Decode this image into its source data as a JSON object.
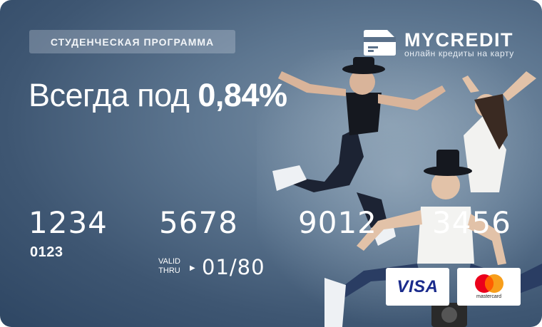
{
  "program_badge": "СТУДЕНЧЕСКАЯ ПРОГРАММА",
  "brand": {
    "name": "MYCREDIT",
    "tagline": "онлайн кредиты на карту",
    "icon": "credit-card-icon"
  },
  "headline": {
    "prefix": "Всегда под",
    "rate": "0,84%"
  },
  "card": {
    "number_groups": [
      "1234",
      "5678",
      "9012",
      "3456"
    ],
    "sub_number": "0123",
    "valid_line1": "VALID",
    "valid_line2": "THRU",
    "valid_arrow": "▶",
    "expiry": "01/80"
  },
  "payment_logos": {
    "visa": "VISA",
    "mastercard": "mastercard"
  },
  "colors": {
    "card_bg": "#4f6883",
    "visa_blue": "#1a2b8c",
    "mc_red": "#eb001b",
    "mc_orange": "#f79e1b"
  }
}
